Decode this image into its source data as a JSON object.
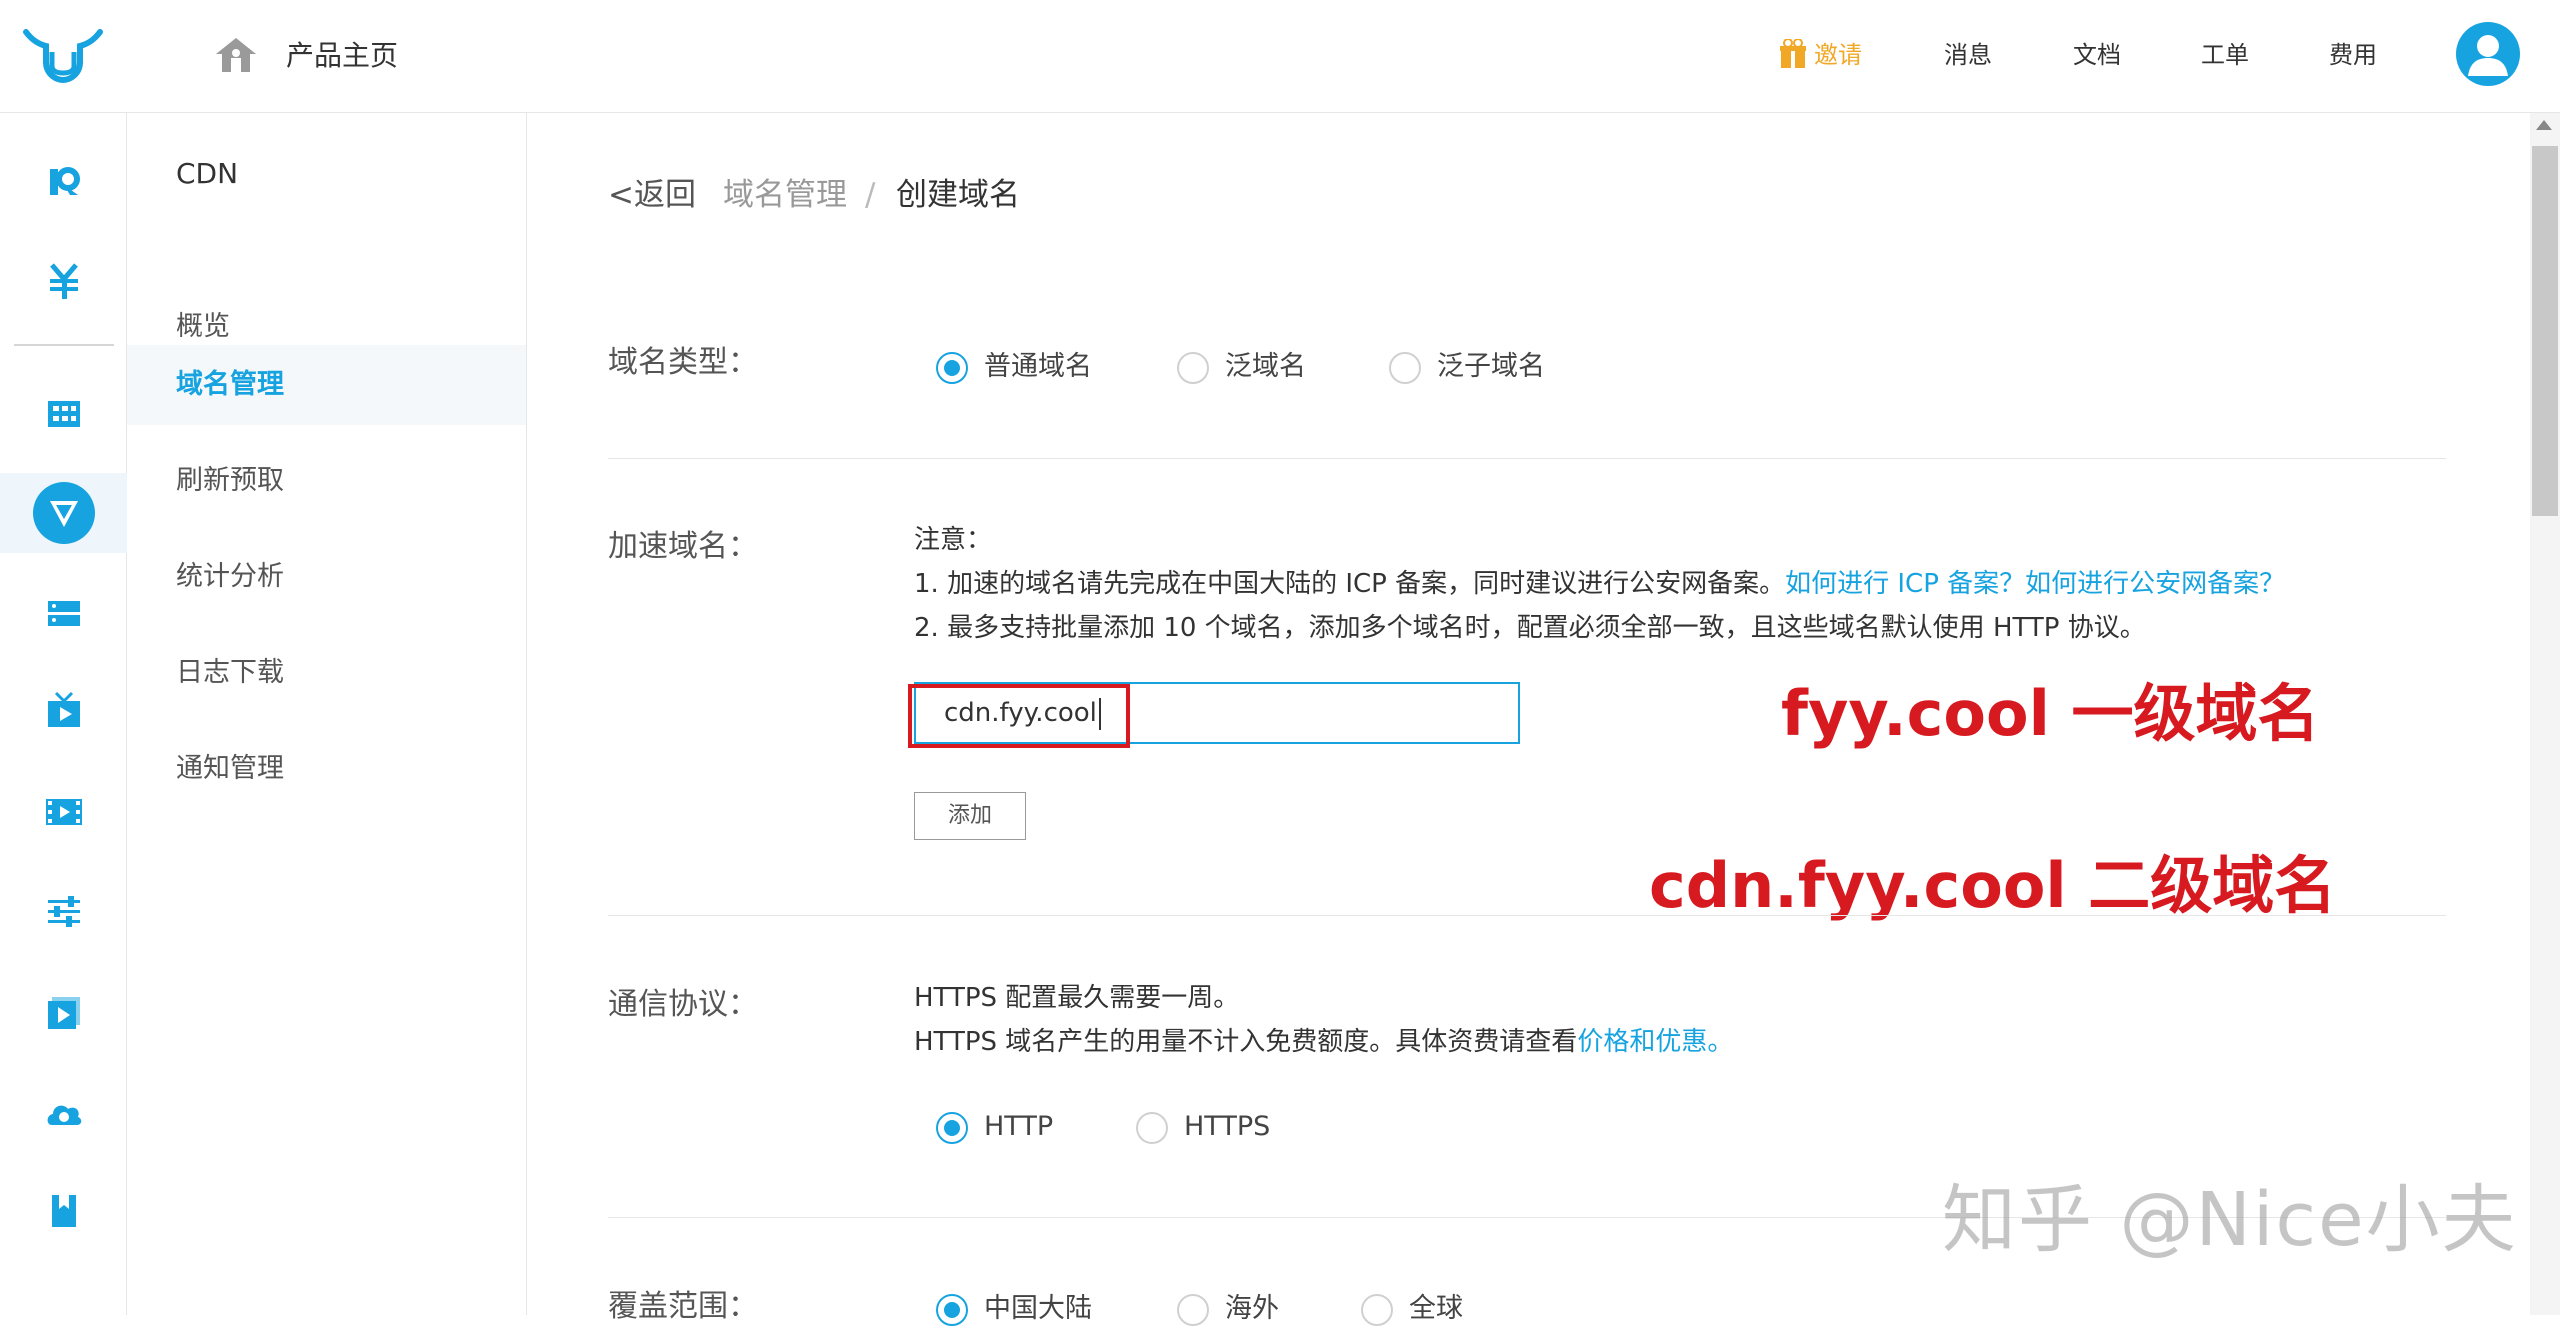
{
  "header": {
    "home_label": "产品主页",
    "invite": "邀请",
    "messages": "消息",
    "docs": "文档",
    "tickets": "工单",
    "billing": "费用"
  },
  "rail": {
    "icons": [
      "kodo-icon",
      "yuan-icon",
      "grid-icon",
      "cdn-icon",
      "server-icon",
      "live-icon",
      "video-icon",
      "sliders-icon",
      "player-icon",
      "cloud-icon",
      "bookmark-icon"
    ],
    "active": "cdn-icon"
  },
  "submenu": {
    "title": "CDN",
    "items": [
      "概览",
      "域名管理",
      "刷新预取",
      "统计分析",
      "日志下载",
      "通知管理"
    ],
    "active_index": 1
  },
  "breadcrumb": {
    "back": "返回",
    "parent": "域名管理",
    "separator": "/",
    "current": "创建域名"
  },
  "form": {
    "domain_type": {
      "label": "域名类型：",
      "options": [
        "普通域名",
        "泛域名",
        "泛子域名"
      ],
      "selected": "普通域名"
    },
    "accel_domain": {
      "label": "加速域名：",
      "note_title": "注意：",
      "note1": "1. 加速的域名请先完成在中国大陆的 ICP 备案，同时建议进行公安网备案。",
      "note1_link": "如何进行 ICP 备案？如何进行公安网备案？",
      "note2": "2. 最多支持批量添加 10 个域名，添加多个域名时，配置必须全部一致，且这些域名默认使用 HTTP 协议。",
      "input_value": "cdn.fyy.cool",
      "add_button": "添加"
    },
    "protocol": {
      "label": "通信协议：",
      "line1": "HTTPS 配置最久需要一周。",
      "line2": "HTTPS 域名产生的用量不计入免费额度。具体资费请查看",
      "line2_link": "价格和优惠。",
      "options": [
        "HTTP",
        "HTTPS"
      ],
      "selected": "HTTP"
    },
    "coverage": {
      "label": "覆盖范围：",
      "options": [
        "中国大陆",
        "海外",
        "全球"
      ],
      "selected": "中国大陆"
    }
  },
  "annotations": {
    "first_level": "fyy.cool 一级域名",
    "second_level": "cdn.fyy.cool 二级域名"
  },
  "watermark": "知乎 @Nice小夫",
  "colors": {
    "accent": "#16a3e0",
    "annotation_red": "#d71920",
    "invite_orange": "#f1a826"
  }
}
